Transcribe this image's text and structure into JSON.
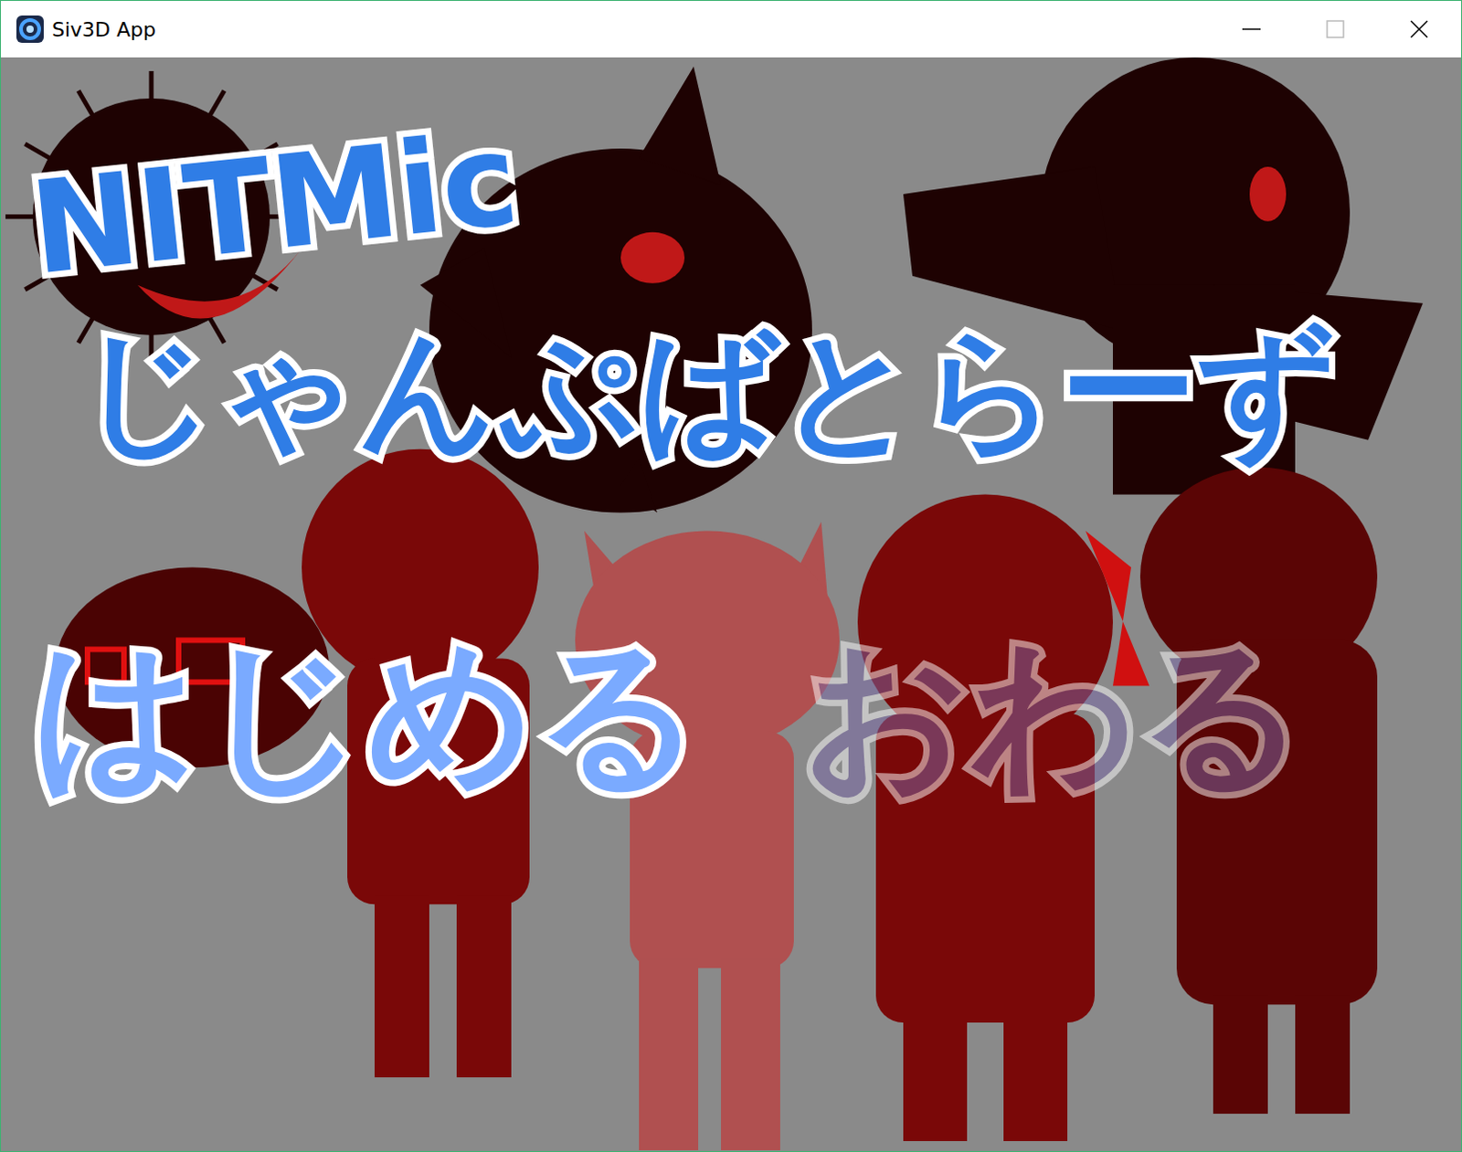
{
  "window": {
    "title": "Siv3D App"
  },
  "title": {
    "logo": "NITMic",
    "name": "じゃんぷばとらーず"
  },
  "menu": [
    {
      "label": "はじめる",
      "selected": true
    },
    {
      "label": "おわる",
      "selected": false
    }
  ]
}
